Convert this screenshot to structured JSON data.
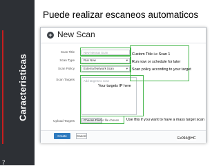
{
  "slide": {
    "title": "Puede realizar escaneos automaticos",
    "side_label": "Caracteristicas",
    "page_number": "7"
  },
  "dialog": {
    "title": "New Scan",
    "icon": "plus-circle-icon",
    "fields": {
      "scan_title": {
        "label": "Scan Title",
        "placeholder": "New Nessus Scan"
      },
      "scan_type": {
        "label": "Scan Type",
        "value": "Run Now"
      },
      "scan_policy": {
        "label": "Scan Policy",
        "value": "External Network Scan"
      },
      "scan_targets": {
        "label": "Scan Targets",
        "placeholder": "Add targets to scan"
      },
      "upload_targets": {
        "label": "Upload Targets",
        "button": "Choose File",
        "hint": "No file chosen"
      }
    },
    "buttons": {
      "create": "Create Scan",
      "cancel": "Cancel"
    }
  },
  "annotations": {
    "custom_title": "Custom Title i.e Scan 1",
    "run_now": "Run now or schedule for later",
    "scan_policy": "Scan policy according to your target",
    "targets": "Your targets IP here",
    "upload": "Use this if you want to have a mass target scan",
    "credit": "Ex094@HC",
    "highlight_color": "#43b549"
  },
  "colors": {
    "sidebar": "#2d3035",
    "sidebar_accent": "#c81e1e",
    "primary_button": "#2f7bbf"
  }
}
